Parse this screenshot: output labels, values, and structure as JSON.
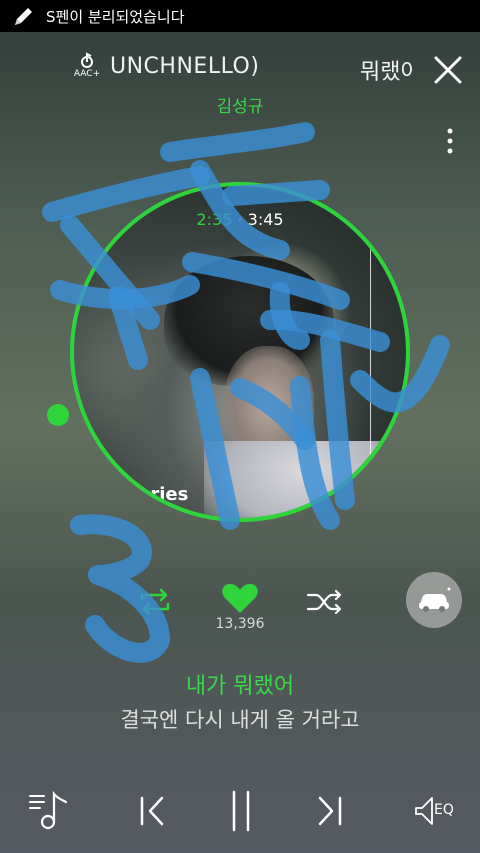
{
  "status_bar": {
    "message": "S펜이 분리되었습니다"
  },
  "header": {
    "aac_label": "AAC+",
    "title_scroll": "UNCHNELLO)",
    "title_next": "뭐랬어",
    "artist": "김성규"
  },
  "player": {
    "time_current": "2:35",
    "time_sep": "·",
    "time_total": "3:45",
    "album_text": "ories",
    "like_count": "13,396"
  },
  "lyrics": {
    "current": "내가 뭐랬어",
    "next": "결국엔 다시 내게 올 거라고"
  },
  "colors": {
    "accent": "#2fd43a",
    "scribble": "#3a8fd6"
  },
  "icons": [
    "pen-icon",
    "aac-icon",
    "close-icon",
    "more-icon",
    "repeat-icon",
    "heart-icon",
    "shuffle-icon",
    "car-icon",
    "playlist-icon",
    "previous-icon",
    "pause-icon",
    "next-icon",
    "eq-icon"
  ],
  "controls": {
    "eq_label": "EQ"
  }
}
